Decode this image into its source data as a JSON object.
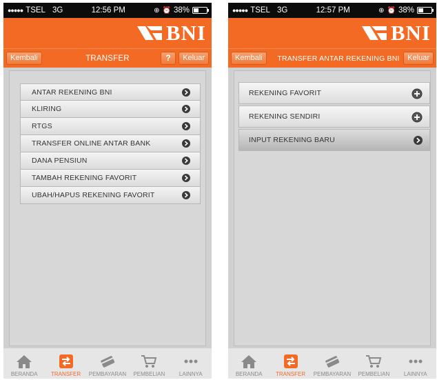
{
  "colors": {
    "brand_orange": "#f36a25",
    "status_bar": "#0c0c0c",
    "panel_gray": "#d7d7d7",
    "tab_inactive": "#8a8a8a"
  },
  "logo": {
    "text": "BNI"
  },
  "tabbar": {
    "items": [
      {
        "label": "BERANDA",
        "icon": "home-icon"
      },
      {
        "label": "TRANSFER",
        "icon": "transfer-icon"
      },
      {
        "label": "PEMBAYARAN",
        "icon": "card-icon"
      },
      {
        "label": "PEMBELIAN",
        "icon": "cart-icon"
      },
      {
        "label": "LAINNYA",
        "icon": "more-icon"
      }
    ]
  },
  "left_screen": {
    "status": {
      "carrier": "TSEL",
      "network": "3G",
      "time": "12:56 PM",
      "battery": "38%",
      "battery_level": 0.38
    },
    "nav": {
      "back_label": "Kembali",
      "title": "TRANSFER",
      "help_label": "?",
      "exit_label": "Keluar"
    },
    "menu": [
      "ANTAR REKENING BNI",
      "KLIRING",
      "RTGS",
      "TRANSFER ONLINE ANTAR BANK",
      "DANA PENSIUN",
      "TAMBAH REKENING FAVORIT",
      "UBAH/HAPUS REKENING FAVORIT"
    ]
  },
  "right_screen": {
    "status": {
      "carrier": "TSEL",
      "network": "3G",
      "time": "12:57 PM",
      "battery": "38%",
      "battery_level": 0.38
    },
    "nav": {
      "back_label": "Kembali",
      "title": "TRANSFER ANTAR REKENING BNI",
      "exit_label": "Keluar"
    },
    "menu": [
      {
        "label": "REKENING FAVORIT",
        "icon": "plus-circle-icon"
      },
      {
        "label": "REKENING SENDIRI",
        "icon": "plus-circle-icon"
      },
      {
        "label": "INPUT REKENING BARU",
        "icon": "arrow-right-icon"
      }
    ]
  }
}
